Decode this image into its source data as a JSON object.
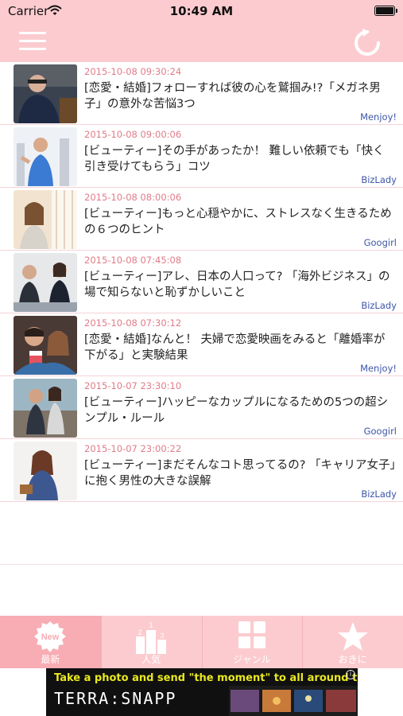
{
  "status_bar": {
    "carrier": "Carrier",
    "time": "10:49 AM"
  },
  "nav": {
    "menu_icon": "hamburger-menu-icon",
    "refresh_icon": "refresh-icon"
  },
  "articles": [
    {
      "date": "2015-10-08 09:30:24",
      "title": "[恋愛・結婚]フォローすれば彼の心を鷲掴み!?「メガネ男子」の意外な苦悩3つ",
      "source": "Menjoy!"
    },
    {
      "date": "2015-10-08 09:00:06",
      "title": "[ビューティー]その手があったか！ 難しい依頼でも「快く引き受けてもらう」コツ",
      "source": "BizLady"
    },
    {
      "date": "2015-10-08 08:00:06",
      "title": "[ビューティー]もっと心穏やかに、ストレスなく生きるための６つのヒント",
      "source": "Googirl"
    },
    {
      "date": "2015-10-08 07:45:08",
      "title": "[ビューティー]アレ、日本の人口って? 「海外ビジネス」の場で知らないと恥ずかしいこと",
      "source": "BizLady"
    },
    {
      "date": "2015-10-08 07:30:12",
      "title": "[恋愛・結婚]なんと！ 夫婦で恋愛映画をみると「離婚率が下がる」と実験結果",
      "source": "Menjoy!"
    },
    {
      "date": "2015-10-07 23:30:10",
      "title": "[ビューティー]ハッピーなカップルになるための5つの超シンプル・ルール",
      "source": "Googirl"
    },
    {
      "date": "2015-10-07 23:00:22",
      "title": "[ビューティー]まだそんなコト思ってるの? 「キャリア女子」に抱く男性の大きな誤解",
      "source": "BizLady"
    }
  ],
  "tabs": [
    {
      "label": "最新",
      "icon": "new-badge-icon",
      "badge": "New",
      "active": true
    },
    {
      "label": "人気",
      "icon": "ranking-podium-icon",
      "active": false
    },
    {
      "label": "ジャンル",
      "icon": "grid-icon",
      "active": false
    },
    {
      "label": "おきに",
      "icon": "star-icon",
      "active": false
    }
  ],
  "ad": {
    "headline": "Take a photo and send \"the moment\" to all around the world.",
    "brand": "TERRA:SNAPP",
    "info_icon": "info-icon",
    "info_symbol": "i"
  },
  "colors": {
    "header_pink": "#fccbcf",
    "active_tab": "#f8acb3",
    "date_text": "#e07c88",
    "source_text": "#3d56a8"
  }
}
